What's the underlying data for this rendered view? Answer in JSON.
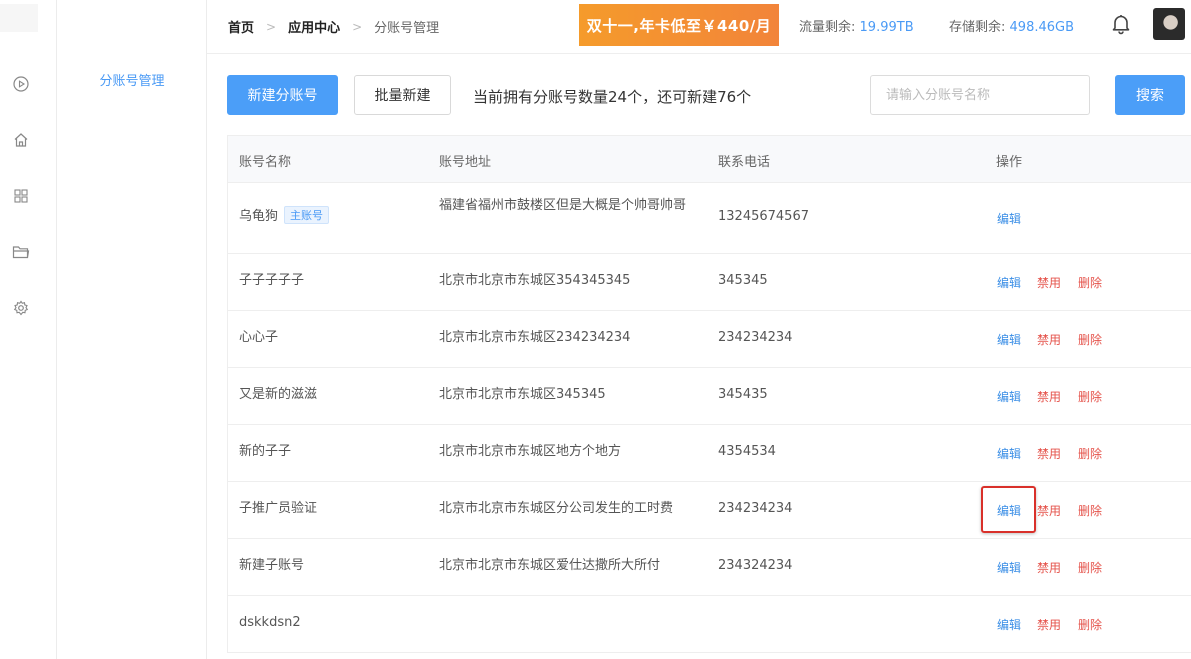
{
  "sidebar": {
    "icons": [
      "play-circle-icon",
      "home-icon",
      "grid-icon",
      "folder-icon",
      "gear-icon"
    ]
  },
  "subnav": {
    "active_item": "分账号管理"
  },
  "breadcrumb": {
    "home": "首页",
    "app_center": "应用中心",
    "current": "分账号管理"
  },
  "banner": {
    "text": "双十一,年卡低至￥440/月"
  },
  "stats": {
    "traffic_label": "流量剩余:",
    "traffic_value": "19.99TB",
    "storage_label": "存储剩余:",
    "storage_value": "498.46GB"
  },
  "toolbar": {
    "new_button": "新建分账号",
    "batch_button": "批量新建",
    "count_text": "当前拥有分账号数量24个，还可新建76个",
    "search_placeholder": "请输入分账号名称",
    "search_button": "搜索"
  },
  "table": {
    "headers": {
      "name": "账号名称",
      "address": "账号地址",
      "phone": "联系电话",
      "actions": "操作"
    },
    "action_labels": {
      "edit": "编辑",
      "disable": "禁用",
      "delete": "删除"
    },
    "main_tag": "主账号",
    "rows": [
      {
        "name": "乌龟狗",
        "address": "福建省福州市鼓楼区但是大概是个帅哥帅哥",
        "phone": "13245674567"
      },
      {
        "name": "子子子子子",
        "address": "北京市北京市东城区354345345",
        "phone": "345345"
      },
      {
        "name": "心心子",
        "address": "北京市北京市东城区234234234",
        "phone": "234234234"
      },
      {
        "name": "又是新的滋滋",
        "address": "北京市北京市东城区345345",
        "phone": "345435"
      },
      {
        "name": "新的子子",
        "address": "北京市北京市东城区地方个地方",
        "phone": "4354534"
      },
      {
        "name": "子推广员验证",
        "address": "北京市北京市东城区分公司发生的工时费",
        "phone": "234234234"
      },
      {
        "name": "新建子账号",
        "address": "北京市北京市东城区爱仕达撒所大所付",
        "phone": "234324234"
      },
      {
        "name": "dskkdsn2",
        "address": "",
        "phone": ""
      }
    ]
  },
  "colors": {
    "accent": "#4b9ef8",
    "danger": "#e5534b",
    "highlight": "#d9302a"
  }
}
